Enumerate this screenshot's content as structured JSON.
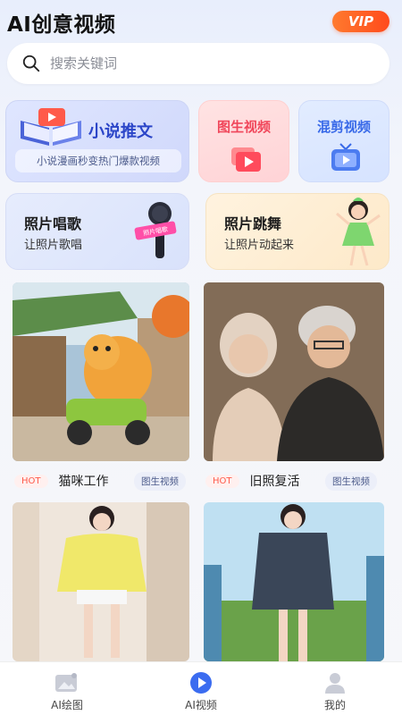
{
  "app": {
    "title": "AI创意视频",
    "vip_label": "VIP"
  },
  "search": {
    "placeholder": "搜索关键词",
    "value": ""
  },
  "features": {
    "novel": {
      "title": "小说推文",
      "subtitle": "小说漫画秒变热门爆款视频"
    },
    "img2video": {
      "title": "图生视频"
    },
    "mix": {
      "title": "混剪视频"
    },
    "photo_sing": {
      "title": "照片唱歌",
      "subtitle": "让照片歌唱",
      "badge": "照片唱歌"
    },
    "photo_dance": {
      "title": "照片跳舞",
      "subtitle": "让照片动起来"
    }
  },
  "feed": [
    {
      "hot": "HOT",
      "title": "猫咪工作",
      "tag": "图生视频"
    },
    {
      "hot": "HOT",
      "title": "旧照复活",
      "tag": "图生视频"
    }
  ],
  "tabbar": [
    {
      "label": "AI绘图",
      "icon": "image-icon"
    },
    {
      "label": "AI视频",
      "icon": "video-play-icon",
      "active": true
    },
    {
      "label": "我的",
      "icon": "profile-icon"
    }
  ],
  "colors": {
    "accent": "#3b6cf0",
    "vip": "#ff5a24",
    "hot": "#ff5a4a"
  }
}
